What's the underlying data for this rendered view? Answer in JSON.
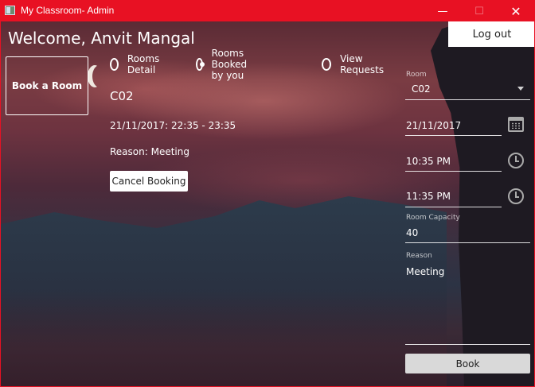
{
  "window": {
    "title": "My Classroom- Admin",
    "minimize_glyph": "—",
    "maximize_glyph": "☐",
    "close_glyph": "✕"
  },
  "header": {
    "welcome": "Welcome, Anvit Mangal",
    "logout_label": "Log out"
  },
  "nav": {
    "book_room_label": "Book a Room",
    "options": [
      {
        "label": "Rooms Detail",
        "selected": false
      },
      {
        "label": "Rooms Booked by you",
        "selected": true
      },
      {
        "label": "View Requests",
        "selected": false
      }
    ]
  },
  "booking": {
    "room": "C02",
    "time": "21/11/2017: 22:35 - 23:35",
    "reason": "Reason: Meeting",
    "cancel_label": "Cancel Booking"
  },
  "form": {
    "room_label": "Room",
    "room_value": "C02",
    "date_value": "21/11/2017",
    "start_time": "10:35 PM",
    "end_time": "11:35 PM",
    "capacity_label": "Room Capacity",
    "capacity_value": "40",
    "reason_label": "Reason",
    "reason_value": "Meeting",
    "book_label": "Book"
  },
  "colors": {
    "titlebar": "#e81123",
    "accent_button": "#ffffff"
  },
  "icons": [
    "app-icon",
    "calendar-icon",
    "clock-icon",
    "chevron-down-icon"
  ]
}
